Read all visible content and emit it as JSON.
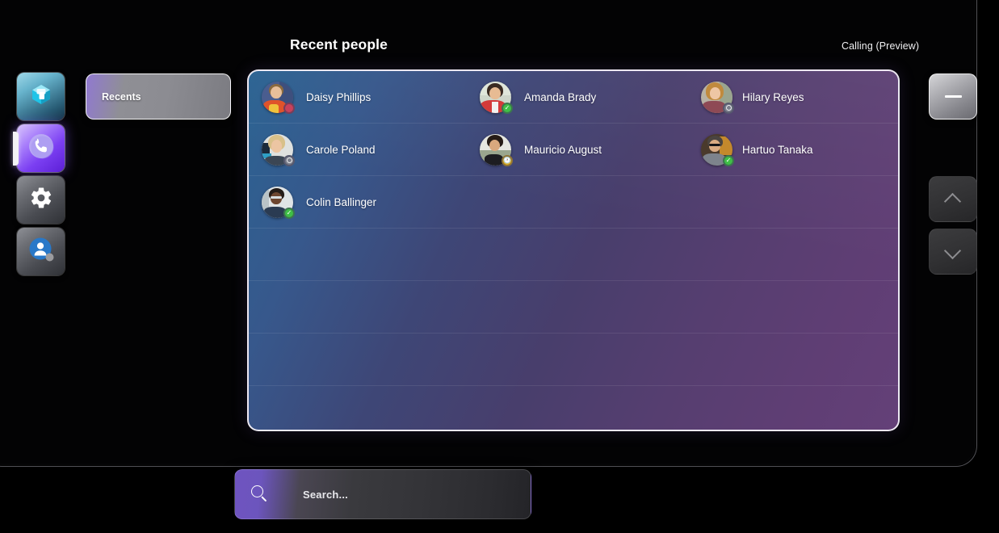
{
  "header": {
    "title": "Recent people",
    "app_label": "Calling (Preview)"
  },
  "sidebar": {
    "items": [
      {
        "name": "teams-app",
        "icon": "teams-logo-icon",
        "active": false
      },
      {
        "name": "calls-app",
        "icon": "phone-icon",
        "active": true
      },
      {
        "name": "settings",
        "icon": "gear-icon",
        "active": false
      },
      {
        "name": "people",
        "icon": "person-icon",
        "active": false
      }
    ]
  },
  "tabs": [
    {
      "label": "Recents",
      "selected": true
    }
  ],
  "people": [
    [
      {
        "name": "Daisy Phillips",
        "presence": "busy",
        "presence_label": "Busy"
      },
      {
        "name": "Amanda Brady",
        "presence": "available",
        "presence_label": "Available"
      },
      {
        "name": "Hilary Reyes",
        "presence": "offline",
        "presence_label": "Offline"
      }
    ],
    [
      {
        "name": "Carole Poland",
        "presence": "offline",
        "presence_label": "Offline"
      },
      {
        "name": "Mauricio August",
        "presence": "away",
        "presence_label": "Away"
      },
      {
        "name": "Hartuo Tanaka",
        "presence": "available",
        "presence_label": "Available"
      }
    ],
    [
      {
        "name": "Colin Ballinger",
        "presence": "available",
        "presence_label": "Available"
      }
    ]
  ],
  "controls": {
    "minimize": "minimize-icon",
    "scroll_up": "chevron-up-icon",
    "scroll_down": "chevron-down-icon"
  },
  "search": {
    "placeholder": "Search...",
    "value": "",
    "icon": "search-icon"
  },
  "colors": {
    "accent_purple": "#7b3ff2",
    "panel_blue": "#2b6392",
    "panel_purple": "#644078",
    "presence_available": "#3fbf46",
    "presence_busy": "#c8415b",
    "presence_away": "#f5ba13",
    "presence_offline": "#7b7f8c",
    "background": "#000000"
  }
}
